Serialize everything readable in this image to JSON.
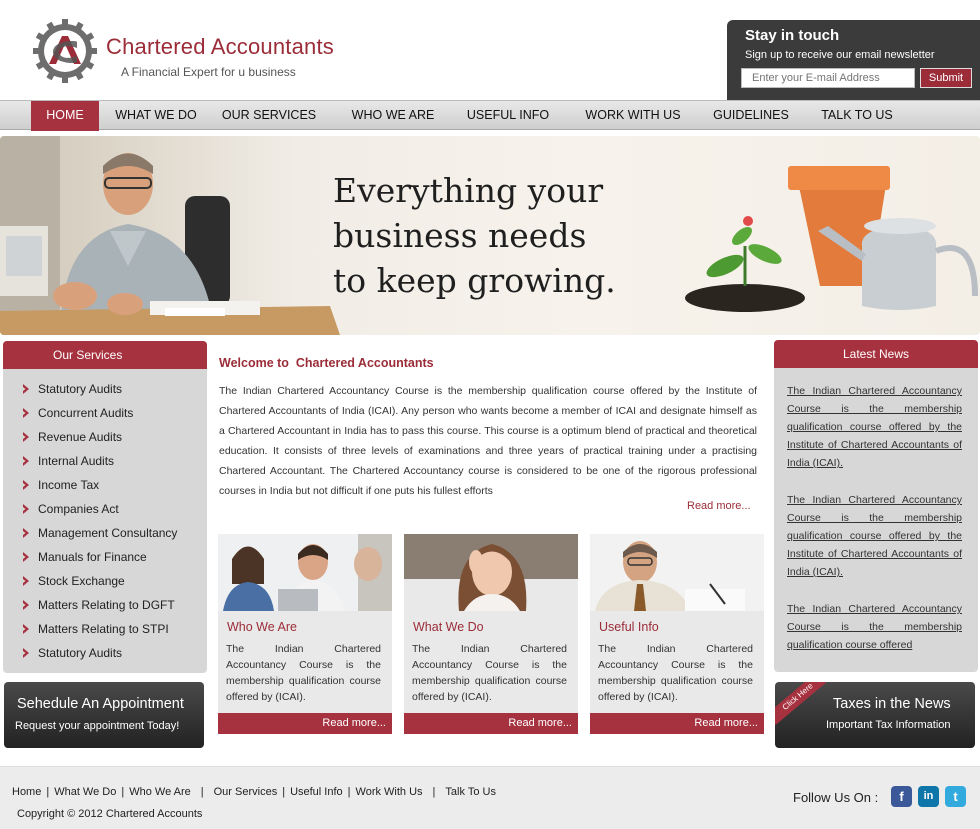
{
  "header": {
    "logo_title": "Chartered Accountants",
    "logo_tagline": "A Financial Expert for u business"
  },
  "newsletter": {
    "title": "Stay in touch",
    "subtitle": "Sign up to receive our email newsletter",
    "placeholder": "Enter your E-mail Address",
    "submit_label": "Submit"
  },
  "nav": {
    "items": [
      {
        "label": "HOME",
        "active": true
      },
      {
        "label": "WHAT WE DO"
      },
      {
        "label": "OUR SERVICES"
      },
      {
        "label": "WHO WE ARE"
      },
      {
        "label": "USEFUL INFO"
      },
      {
        "label": "WORK WITH US"
      },
      {
        "label": "GUIDELINES"
      },
      {
        "label": "TALK TO US"
      }
    ]
  },
  "banner": {
    "line1": "Everything your",
    "line2": "business needs",
    "line3": "to keep growing."
  },
  "services": {
    "title": "Our Services",
    "items": [
      "Statutory Audits",
      "Concurrent Audits",
      "Revenue Audits",
      "Internal Audits",
      "Income Tax",
      "Companies Act",
      "Management Consultancy",
      "Manuals for Finance",
      "Stock Exchange",
      "Matters Relating to DGFT",
      "Matters Relating to STPI",
      "Statutory Audits"
    ]
  },
  "appointment": {
    "title": "Sehedule An Appointment",
    "subtitle": "Request your appointment Today!"
  },
  "welcome": {
    "title": "Welcome to  Chartered Accountants",
    "body": "The Indian Chartered Accountancy Course is the membership qualification course offered by the Institute of Chartered Accountants of India (ICAI). Any person who wants become a member of ICAI and designate himself as a Chartered Accountant in India has to pass this course. This course is a optimum blend of practical and theoretical education. It consists of three levels of examinations and three years of practical training under a practising Chartered Accountant. The Chartered Accountancy course is considered to be one of the rigorous professional courses in India but not difficult if one puts his fullest efforts",
    "read_more": "Read more..."
  },
  "cards": [
    {
      "title": "Who We Are",
      "text": "The Indian Chartered Accountancy Course is the membership qualification course offered by (ICAI).",
      "button": "Read more..."
    },
    {
      "title": "What We Do",
      "text": "The Indian Chartered Accountancy Course is the membership qualification course offered by (ICAI).",
      "button": "Read more..."
    },
    {
      "title": "Useful Info",
      "text": "The Indian Chartered Accountancy Course is the membership qualification course offered by (ICAI).",
      "button": "Read more..."
    }
  ],
  "news": {
    "title": "Latest News",
    "items": [
      "The Indian Chartered Accountancy Course is the membership qualification course offered by the Institute of Chartered Accountants of India (ICAI).",
      "The Indian Chartered Accountancy Course is the membership qualification course offered by the Institute of Chartered Accountants of India (ICAI).",
      "The Indian Chartered Accountancy Course is the membership qualification course offered"
    ]
  },
  "taxes": {
    "ribbon": "Click Here",
    "title": "Taxes in the News",
    "subtitle": "Important Tax Information"
  },
  "footer": {
    "links": [
      "Home",
      "What We Do",
      "Who We Are",
      "Our Services",
      "Useful Info",
      "Work With Us",
      "Talk To Us"
    ],
    "copyright": "Copyright © 2012 Chartered Accounts",
    "follow": "Follow Us On :"
  },
  "colors": {
    "accent": "#a7323f",
    "dark": "#3b3b3b",
    "panel": "#d7d7d7",
    "facebook": "#3b5998",
    "linkedin": "#0e76a8",
    "twitter": "#33aadd"
  }
}
